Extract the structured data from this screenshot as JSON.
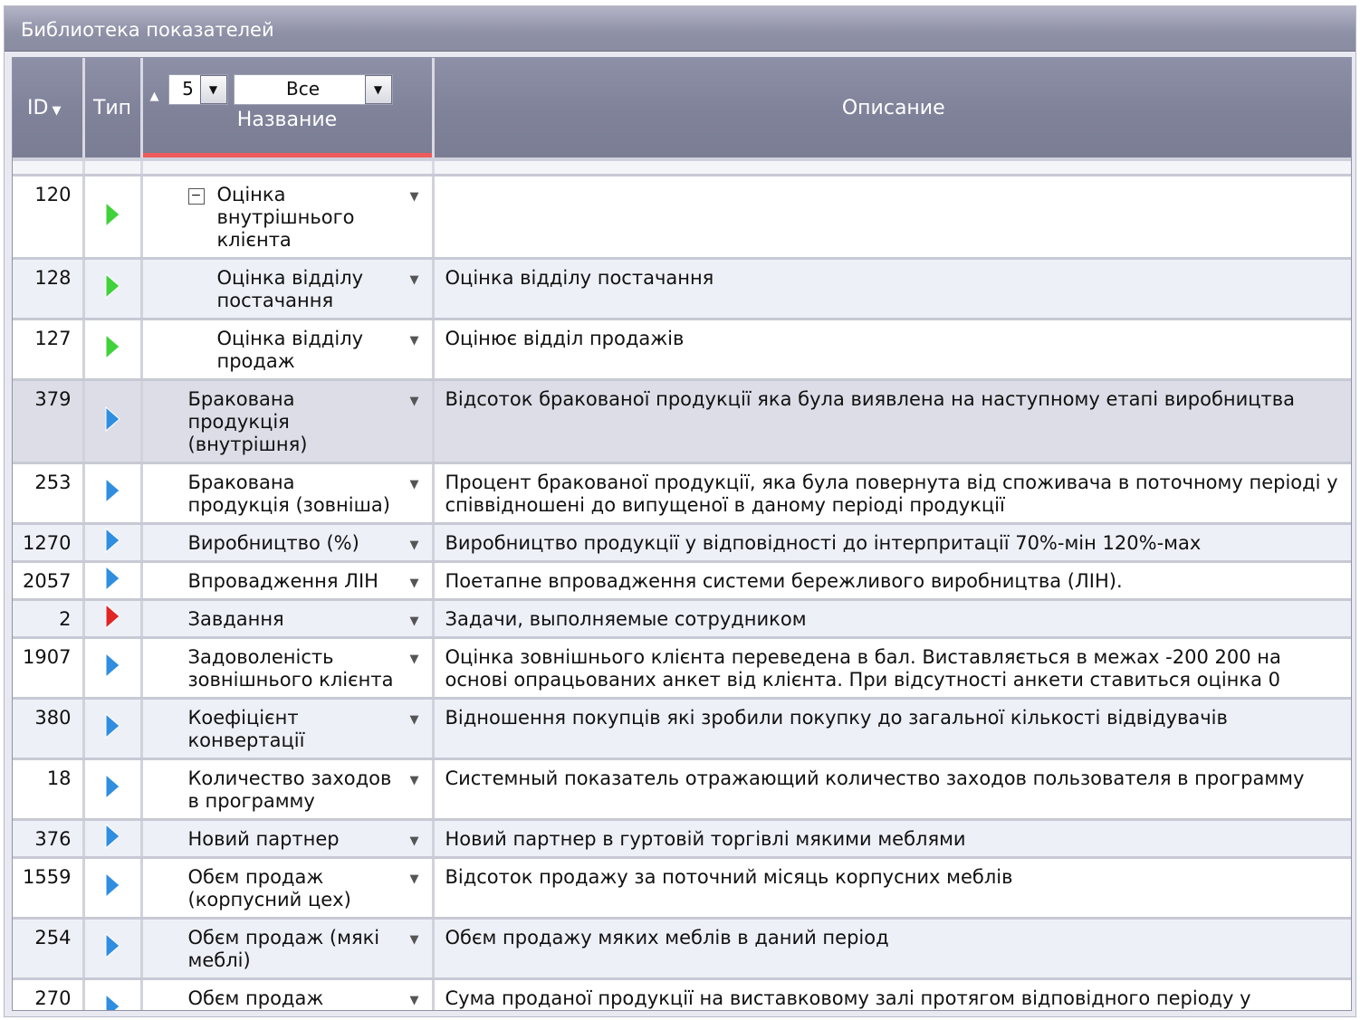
{
  "window": {
    "title": "Библиотека показателей"
  },
  "columns": {
    "id": "ID",
    "type": "Тип",
    "name": "Название",
    "description": "Описание"
  },
  "filters": {
    "level_value": "5",
    "group_value": "Все"
  },
  "colors": {
    "green_type": "#3fd23a",
    "blue_type": "#2f8ee0",
    "red_type": "#e32424",
    "header_bg": "#8d90a7",
    "sort_indicator": "#ee5b5b"
  },
  "rows": [
    {
      "id": "120",
      "type": "green",
      "name": "Оцінка внутрішнього клієнта",
      "description": ""
    },
    {
      "id": "128",
      "type": "green",
      "name": "Оцінка відділу постачання",
      "description": "Оцінка відділу постачання"
    },
    {
      "id": "127",
      "type": "green",
      "name": "Оцінка відділу продаж",
      "description": "Оцінює відділ продажів"
    },
    {
      "id": "379",
      "type": "blue",
      "name": "Бракована продукція (внутрішня)",
      "description": "Відсоток бракованої продукції яка була виявлена на наступному етапі виробництва"
    },
    {
      "id": "253",
      "type": "blue",
      "name": "Бракована продукція (зовніша)",
      "description": "Процент бракованої продукції, яка була повернута від споживача в поточному періоді у співвідношені до випущеної в даному періоді продукції"
    },
    {
      "id": "1270",
      "type": "blue",
      "name": "Виробництво (%)",
      "description": "Виробництво продукції у відповідності до інтерпритації 70%-мін 120%-мах"
    },
    {
      "id": "2057",
      "type": "blue",
      "name": "Впровадження ЛІН",
      "description": "Поетапне впровадження системи бережливого виробництва (ЛІН)."
    },
    {
      "id": "2",
      "type": "red",
      "name": "Завдання",
      "description": "Задачи, выполняемые сотрудником"
    },
    {
      "id": "1907",
      "type": "blue",
      "name": "Задоволеність зовнішнього клієнта",
      "description": "Оцінка зовнішнього клієнта переведена в бал. Виставляється в межах -200 200 на основі опрацьованих анкет від клієнта. При відсутності анкети ставиться оцінка 0"
    },
    {
      "id": "380",
      "type": "blue",
      "name": "Коефіцієнт конвертації",
      "description": "Відношення покупців які зробили покупку до загальної кількості відвідувачів"
    },
    {
      "id": "18",
      "type": "blue",
      "name": "Количество заходов в программу",
      "description": "Системный показатель отражающий количество заходов пользователя в программу"
    },
    {
      "id": "376",
      "type": "blue",
      "name": "Новий партнер",
      "description": "Новий партнер в гуртовій торгівлі мякими меблями"
    },
    {
      "id": "1559",
      "type": "blue",
      "name": "Обєм продаж (корпусний цех)",
      "description": "Відсоток продажу за поточний місяць корпусних меблів"
    },
    {
      "id": "254",
      "type": "blue",
      "name": "Обєм продаж (мякі меблі)",
      "description": "Обєм продажу мяких меблів в даний період"
    },
    {
      "id": "270",
      "type": "blue",
      "name": "Обєм продаж виставковий зал",
      "description": "Сума проданої продукції на виставковому залі протягом відповідного періоду у відсотках до  планового показника"
    }
  ]
}
